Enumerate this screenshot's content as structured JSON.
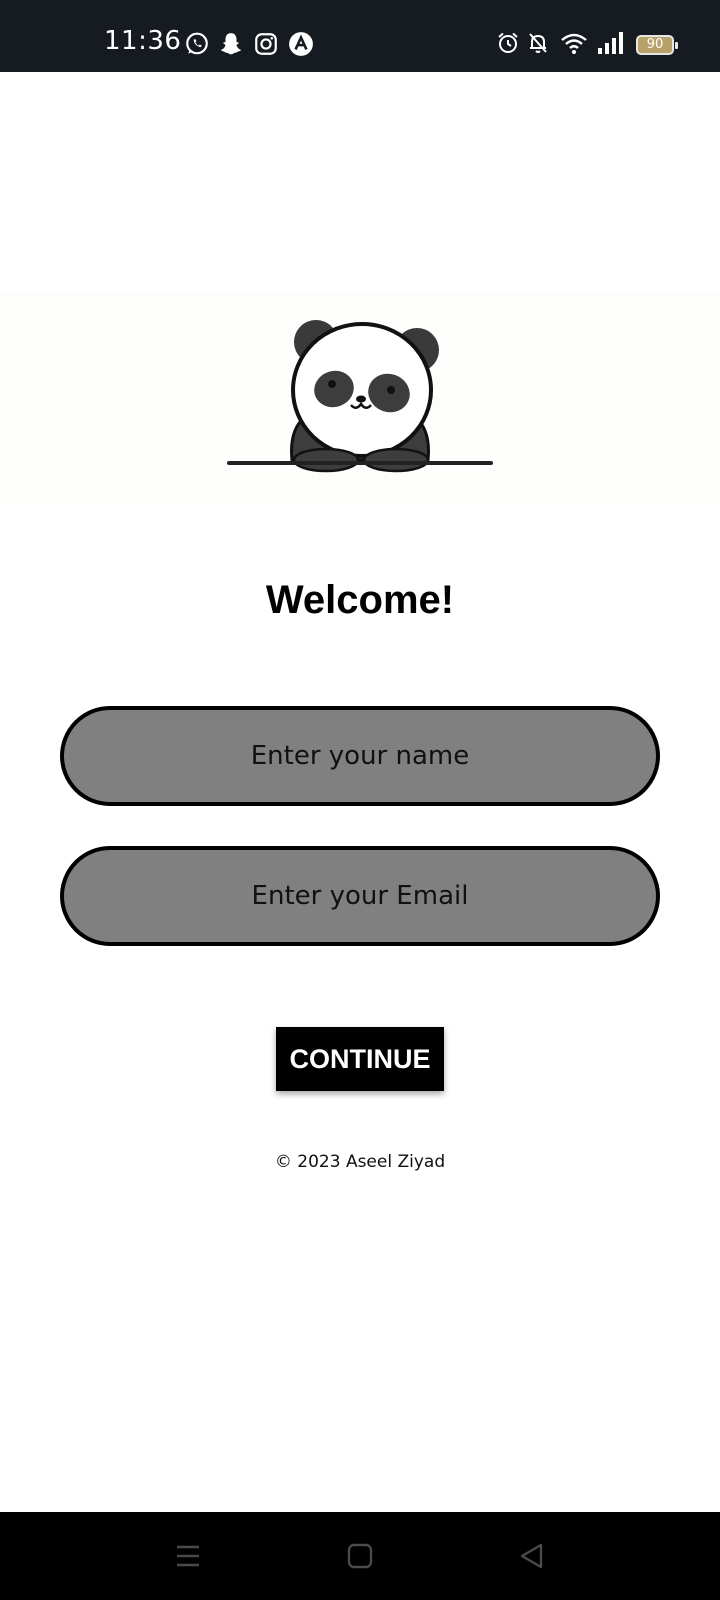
{
  "status_bar": {
    "time": "11:36",
    "battery_level": "90",
    "left_icons": [
      "whatsapp-icon",
      "snapchat-icon",
      "instagram-icon",
      "app-a-icon"
    ],
    "right_icons": [
      "alarm-icon",
      "bell-muted-icon",
      "wifi-icon",
      "signal-icon",
      "battery-icon"
    ]
  },
  "banner": {
    "image": "panda-illustration"
  },
  "welcome": {
    "title": "Welcome!"
  },
  "form": {
    "name_placeholder": "Enter your name",
    "name_value": "",
    "email_placeholder": "Enter your Email",
    "email_value": ""
  },
  "continue_button": {
    "label": "CONTINUE"
  },
  "footer": {
    "copyright": "© 2023 Aseel Ziyad"
  },
  "nav_bar": {
    "buttons": [
      "menu-icon",
      "home-icon",
      "back-icon"
    ]
  },
  "colors": {
    "status_bar_bg": "#161b22",
    "input_fill": "#808080",
    "input_border": "#000000",
    "button_bg": "#000000",
    "button_text": "#ffffff",
    "nav_bar_bg": "#000000"
  }
}
